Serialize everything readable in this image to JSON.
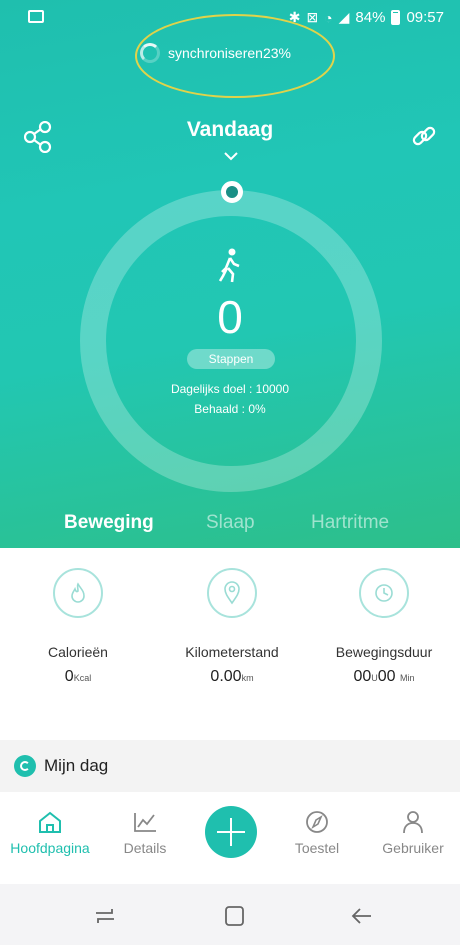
{
  "status_bar": {
    "battery": "84%",
    "time": "09:57"
  },
  "sync": {
    "label": "synchroniseren23%"
  },
  "header": {
    "title": "Vandaag"
  },
  "activity": {
    "steps": "0",
    "steps_label": "Stappen",
    "daily_goal": "Dagelijks doel : 10000",
    "achieved": "Behaald : 0%"
  },
  "tabs": [
    {
      "label": "Beweging",
      "active": true
    },
    {
      "label": "Slaap",
      "active": false
    },
    {
      "label": "Hartritme",
      "active": false
    }
  ],
  "metrics": [
    {
      "label": "Calorieën",
      "value": "0",
      "unit": "Kcal",
      "icon": "flame-icon"
    },
    {
      "label": "Kilometerstand",
      "value": "0.00",
      "unit": "km",
      "icon": "location-pin-icon"
    },
    {
      "label": "Bewegingsduur",
      "value_hours": "00",
      "unit_hours": "U",
      "value_minutes": "00",
      "unit_minutes": "Min",
      "icon": "clock-icon"
    }
  ],
  "my_day": {
    "label": "Mijn dag"
  },
  "bottom_nav": [
    {
      "label": "Hoofdpagina",
      "icon": "home-icon",
      "active": true
    },
    {
      "label": "Details",
      "icon": "chart-icon",
      "active": false
    },
    {
      "label": "Toestel",
      "icon": "compass-icon",
      "active": false
    },
    {
      "label": "Gebruiker",
      "icon": "user-icon",
      "active": false
    }
  ],
  "colors": {
    "accent": "#1fbfae",
    "highlight_ellipse": "#e0d34a"
  }
}
